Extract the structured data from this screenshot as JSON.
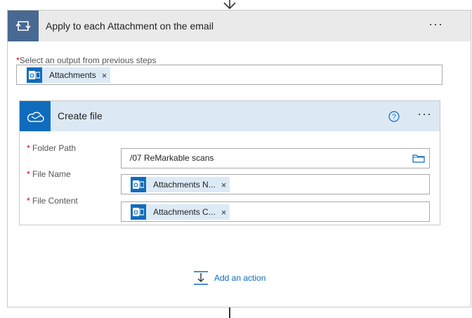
{
  "loop": {
    "title": "Apply to each Attachment on the email",
    "more": "···",
    "select_label": "Select an output from previous steps",
    "required_mark": "*",
    "token": {
      "label": "Attachments",
      "remove": "×"
    }
  },
  "create_file": {
    "title": "Create file",
    "more": "···",
    "fields": [
      {
        "label": "Folder Path",
        "value": "/07 ReMarkable scans"
      },
      {
        "label": "File Name",
        "token": "Attachments N...",
        "remove": "×"
      },
      {
        "label": "File Content",
        "token": "Attachments C...",
        "remove": "×"
      }
    ]
  },
  "add_action": {
    "label": "Add an action"
  },
  "colors": {
    "loop_header": "#486991",
    "onedrive_blue": "#0f6cbd",
    "outlook_blue": "#0f6cbd",
    "token_bg": "#dceaf6",
    "link": "#0f6cbd"
  },
  "icons": {
    "loop": "loop-icon",
    "onedrive": "onedrive-icon",
    "outlook": "outlook-icon",
    "help": "help-icon",
    "folder": "folder-icon",
    "add_action": "add-action-icon"
  }
}
